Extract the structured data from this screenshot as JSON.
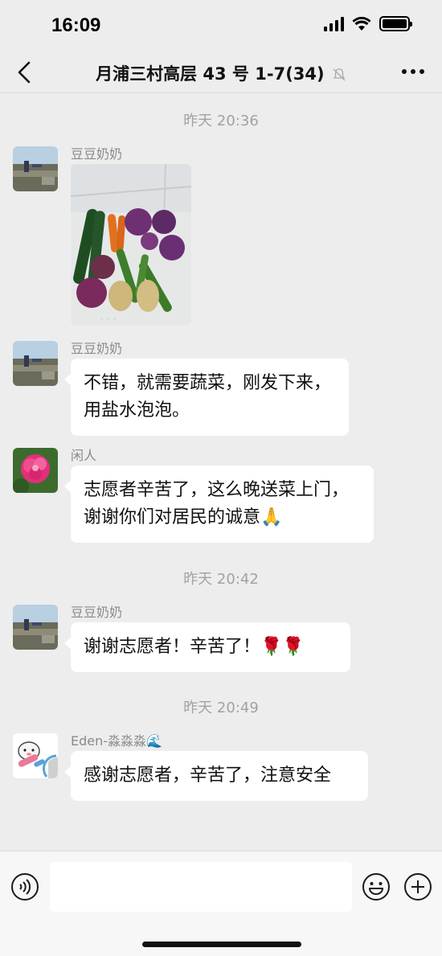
{
  "status": {
    "time": "16:09"
  },
  "header": {
    "title": "月浦三村高层 43 号 1-7",
    "count": "(34)"
  },
  "chat": {
    "timestamps": [
      "昨天 20:36",
      "昨天 20:42",
      "昨天 20:49"
    ],
    "messages": [
      {
        "sender": "豆豆奶奶",
        "type": "image"
      },
      {
        "sender": "豆豆奶奶",
        "text": "不错，就需要蔬菜，刚发下来，用盐水泡泡。"
      },
      {
        "sender": "闲人",
        "text": "志愿者辛苦了，这么晚送菜上门，谢谢你们对居民的诚意🙏"
      },
      {
        "sender": "豆豆奶奶",
        "text": "谢谢志愿者！辛苦了！🌹🌹"
      },
      {
        "sender": "Eden-淼淼淼🌊",
        "text": "感谢志愿者，辛苦了，注意安全"
      }
    ]
  },
  "input": {
    "placeholder": ""
  },
  "colors": {
    "background": "#ededed",
    "bubble": "#ffffff",
    "timestamp": "#a2a2a2"
  }
}
